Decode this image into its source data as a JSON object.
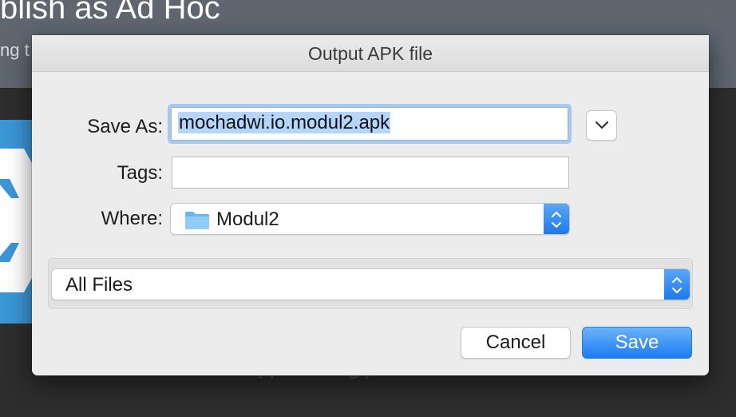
{
  "background_app": {
    "title": "blish as Ad Hoc",
    "subtitle": "ng t",
    "status": "Your app is being published..."
  },
  "dialog": {
    "title": "Output APK file",
    "save_as": {
      "label": "Save As:",
      "value": "mochadwi.io.modul2.apk"
    },
    "tags": {
      "label": "Tags:",
      "value": ""
    },
    "where": {
      "label": "Where:",
      "value": "Modul2",
      "icon": "folder-icon"
    },
    "file_type": {
      "value": "All Files"
    },
    "buttons": {
      "cancel": "Cancel",
      "save": "Save"
    }
  },
  "colors": {
    "accent": "#1a7cf2",
    "selection": "#b4d5fe",
    "folder": "#68b8ef",
    "logo_tile": "#3b96d6"
  }
}
